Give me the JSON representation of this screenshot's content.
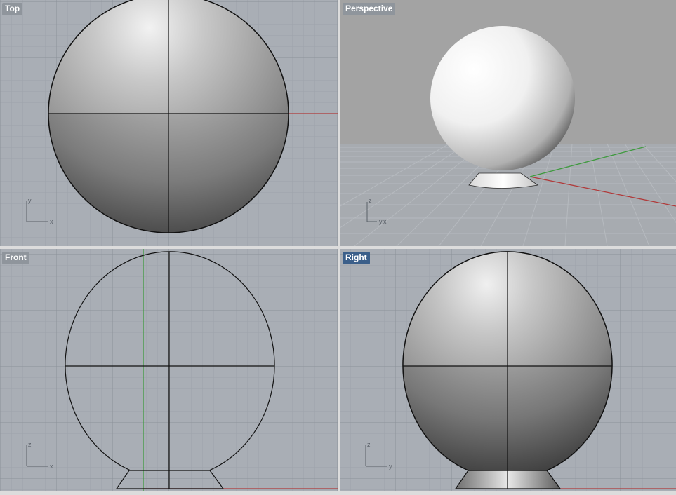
{
  "viewports": {
    "top": {
      "title": "Top",
      "axis_h": "x",
      "axis_v": "y",
      "active": false
    },
    "persp": {
      "title": "Perspective",
      "axis_h": "y",
      "axis_h2": "x",
      "axis_v": "z",
      "active": false
    },
    "front": {
      "title": "Front",
      "axis_h": "x",
      "axis_v": "z",
      "active": false
    },
    "right": {
      "title": "Right",
      "axis_h": "y",
      "axis_v": "z",
      "active": true
    }
  },
  "colors": {
    "viewport_bg": "#a9aeb5",
    "perspective_bg": "#a3a3a3",
    "grid_minor": "#9ba1a8",
    "grid_major": "#8b9098",
    "x_axis": "#b03a3a",
    "y_axis": "#3f9a3f",
    "active_label": "#3b5f8a",
    "label_bg": "#8f959c"
  }
}
